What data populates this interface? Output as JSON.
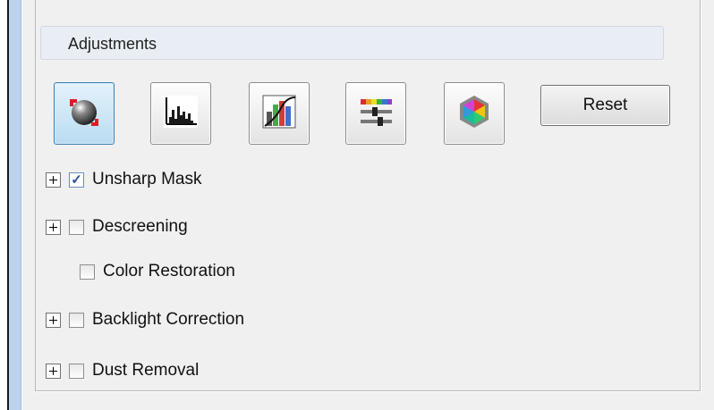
{
  "section": {
    "title": "Adjustments"
  },
  "toolbar": {
    "buttons": [
      {
        "name": "auto-exposure",
        "icon": "auto-exposure-icon",
        "active": true
      },
      {
        "name": "histogram",
        "icon": "histogram-icon",
        "active": false
      },
      {
        "name": "tone-correction",
        "icon": "tone-curve-icon",
        "active": false
      },
      {
        "name": "image-adjustment",
        "icon": "color-sliders-icon",
        "active": false
      },
      {
        "name": "color-palette",
        "icon": "color-palette-icon",
        "active": false
      }
    ],
    "reset_label": "Reset"
  },
  "options": [
    {
      "label": "Unsharp Mask",
      "checked": true,
      "expandable": true,
      "mnemonic": "k"
    },
    {
      "label": "Descreening",
      "checked": false,
      "expandable": true,
      "mnemonic": "e"
    },
    {
      "label": "Color Restoration",
      "checked": false,
      "expandable": false,
      "mnemonic": "r"
    },
    {
      "label": "Backlight Correction",
      "checked": false,
      "expandable": true,
      "mnemonic": "B"
    },
    {
      "label": "Dust Removal",
      "checked": false,
      "expandable": true,
      "mnemonic": "D"
    }
  ],
  "colors": {
    "active_button_bg": "#b9dcf2",
    "active_button_border": "#3c7fb1",
    "header_bg": "#e9eef4",
    "sidebar_blue": "#bcd3ee",
    "checkmark": "#2b4d8f"
  }
}
